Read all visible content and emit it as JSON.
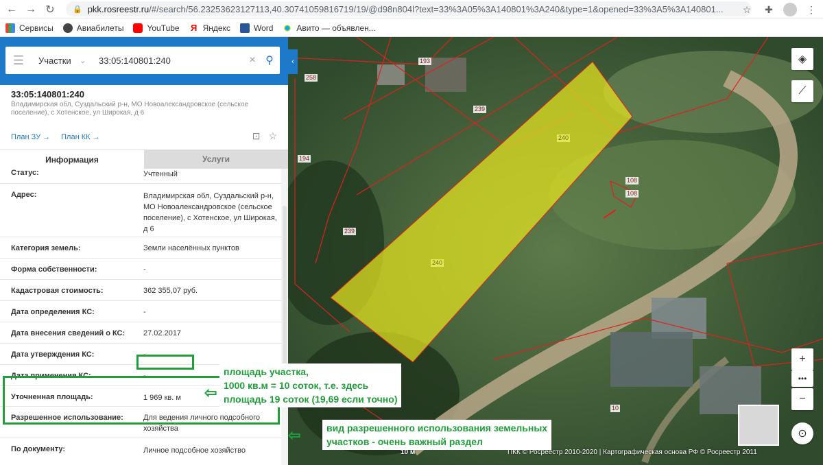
{
  "browser": {
    "url_host": "pkk.rosreestr.ru",
    "url_rest": "/#/search/56.23253623127113,40.30741059816719/19/@d98n804l?text=33%3A05%3A140801%3A240&type=1&opened=33%3A5%3A140801...",
    "bookmarks": [
      "Сервисы",
      "Авиабилеты",
      "YouTube",
      "Яндекс",
      "Word",
      "Авито — объявлен..."
    ]
  },
  "search": {
    "type_label": "Участки",
    "query": "33:05:140801:240"
  },
  "parcel": {
    "number": "33:05:140801:240",
    "address_short": "Владимирская обл, Суздальский р-н, МО Новоалександровское (сельское поселение), с Хотенское, ул Широкая, д 6",
    "plan_zu": "План ЗУ →",
    "plan_kk": "План КК →"
  },
  "tabs": {
    "info": "Информация",
    "services": "Услуги"
  },
  "fields": [
    {
      "label": "Статус:",
      "value": "Учтенный"
    },
    {
      "label": "Адрес:",
      "value": "Владимирская обл, Суздальский р-н, МО Новоалександровское (сельское поселение), с Хотенское, ул Широкая, д 6"
    },
    {
      "label": "Категория земель:",
      "value": "Земли населённых пунктов"
    },
    {
      "label": "Форма собственности:",
      "value": "-"
    },
    {
      "label": "Кадастровая стоимость:",
      "value": "362 355,07 руб."
    },
    {
      "label": "Дата определения КС:",
      "value": "-"
    },
    {
      "label": "Дата внесения сведений о КС:",
      "value": "27.02.2017"
    },
    {
      "label": "Дата утверждения КС:",
      "value": "-"
    },
    {
      "label": "Дата применения КС:",
      "value": "-"
    },
    {
      "label": "Уточненная площадь:",
      "value": "1 969 кв. м"
    },
    {
      "label": "Разрешенное использование:",
      "value": "Для ведения личного подсобного хозяйства"
    },
    {
      "label": "По документу:",
      "value": "Личное подсобное хозяйство"
    }
  ],
  "map": {
    "labels": [
      "193",
      "258",
      "239",
      "240",
      "194",
      "108",
      "108",
      "239",
      "240",
      "10"
    ],
    "scale": "10 м",
    "copyright": "ПКК © Росреестр 2010-2020 | Картографическая основа РФ © Росреестр 2011",
    "colors": {
      "parcel_fill": "#e6e61e",
      "boundary": "#e02020"
    }
  },
  "annotations": {
    "area_note": [
      "площадь участка,",
      "1000 кв.м = 10 соток, т.е. здесь",
      "площадь 19 соток (19,69 если точно)"
    ],
    "usage_note": [
      "вид разрешенного использования земельных",
      "участков - очень важный раздел"
    ],
    "color": "#1f9e3a"
  }
}
